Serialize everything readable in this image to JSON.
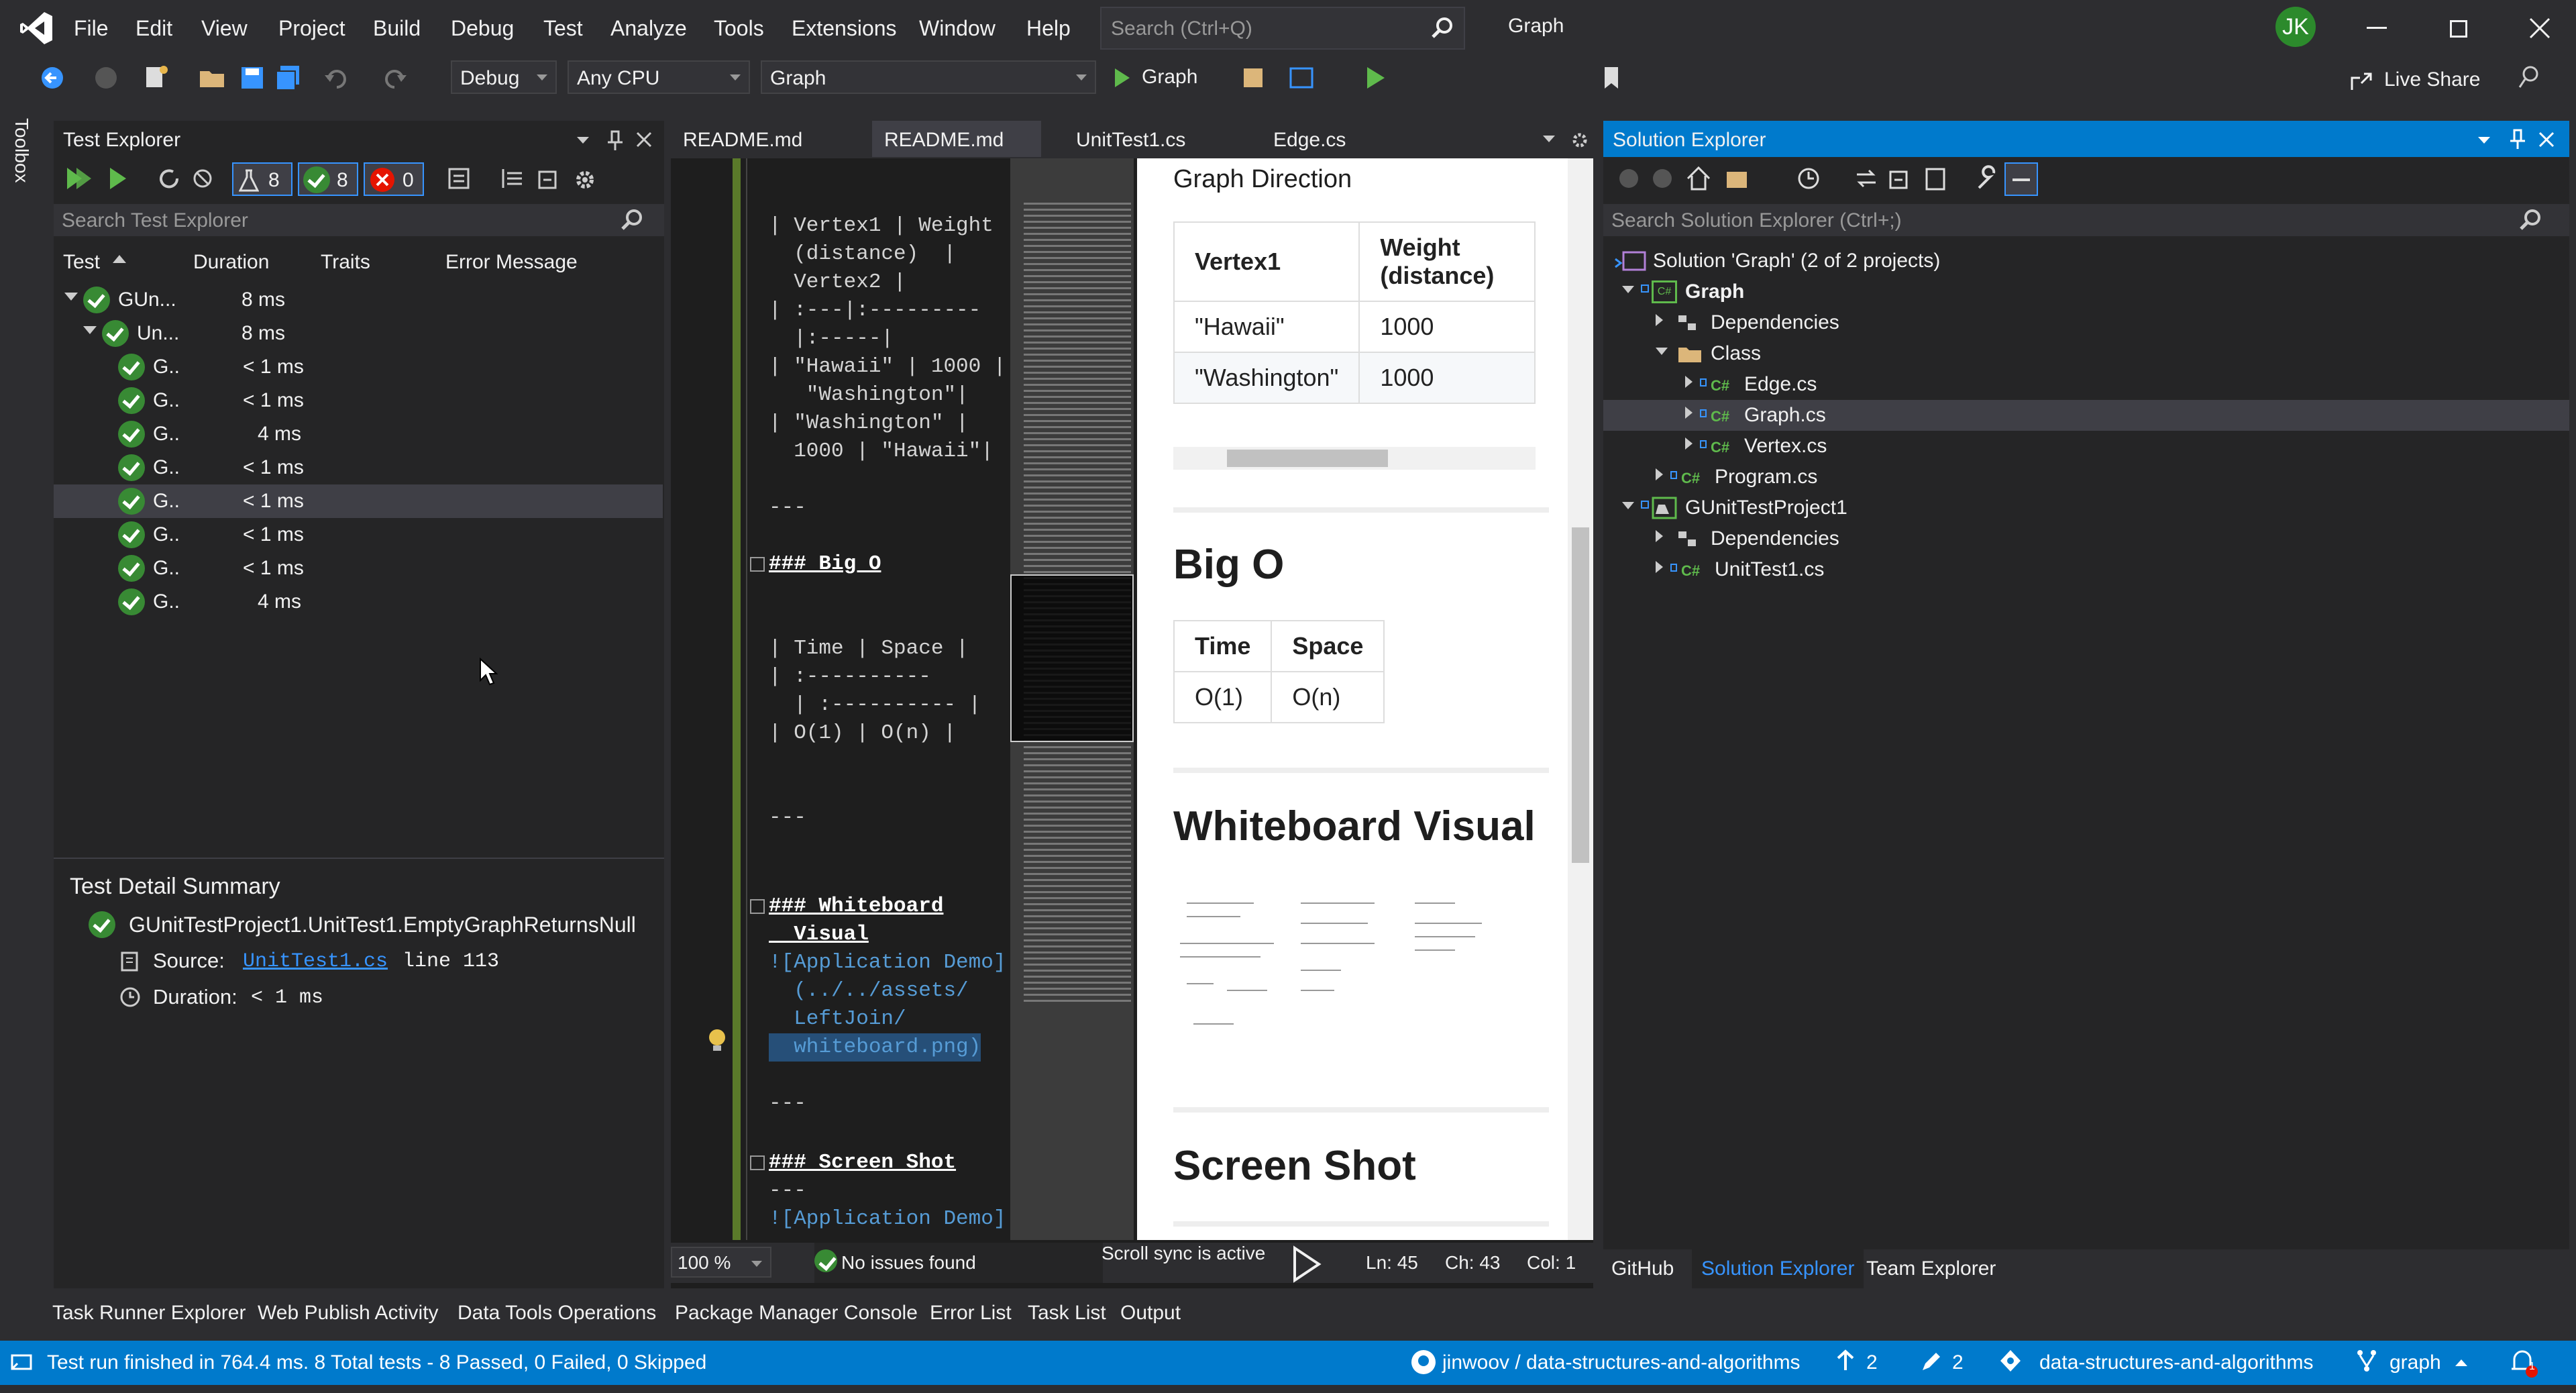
{
  "menu": [
    "File",
    "Edit",
    "View",
    "Project",
    "Build",
    "Debug",
    "Test",
    "Analyze",
    "Tools",
    "Extensions",
    "Window",
    "Help"
  ],
  "search": {
    "placeholder": "Search (Ctrl+Q)"
  },
  "solution_name": "Graph",
  "user_initials": "JK",
  "live_share": "Live Share",
  "toolbar": {
    "config": "Debug",
    "platform": "Any CPU",
    "startup": "Graph",
    "run_label": "Graph"
  },
  "toolbox_label": "Toolbox",
  "test_explorer": {
    "title": "Test Explorer",
    "counts": {
      "total": "8",
      "passed": "8",
      "failed": "0"
    },
    "search_placeholder": "Search Test Explorer",
    "columns": [
      "Test",
      "Duration",
      "Traits",
      "Error Message"
    ],
    "rows": [
      {
        "name": "GUn...",
        "duration": "8 ms"
      },
      {
        "name": "Un...",
        "duration": "8 ms"
      },
      {
        "name": "G..",
        "duration": "< 1 ms"
      },
      {
        "name": "G..",
        "duration": "< 1 ms"
      },
      {
        "name": "G..",
        "duration": "4 ms"
      },
      {
        "name": "G..",
        "duration": "< 1 ms"
      },
      {
        "name": "G..",
        "duration": "< 1 ms"
      },
      {
        "name": "G..",
        "duration": "< 1 ms"
      },
      {
        "name": "G..",
        "duration": "< 1 ms"
      },
      {
        "name": "G..",
        "duration": "4 ms"
      }
    ],
    "detail": {
      "title": "Test Detail Summary",
      "test_name": "GUnitTestProject1.UnitTest1.EmptyGraphReturnsNull",
      "source_label": "Source:",
      "source_file": "UnitTest1.cs",
      "source_line": "line 113",
      "duration_label": "Duration:",
      "duration_value": "< 1 ms"
    }
  },
  "editor": {
    "tabs": [
      "README.md",
      "README.md",
      "UnitTest1.cs",
      "Edge.cs"
    ],
    "code": [
      "| Vertex1 | Weight",
      "  (distance)  |",
      "  Vertex2 |",
      "| :---|:---------",
      "  |:-----|",
      "| \"Hawaii\" | 1000 |",
      "   \"Washington\"|",
      "| \"Washington\" |",
      "  1000 | \"Hawaii\"|",
      "---",
      "### Big O",
      "| Time | Space |",
      "| :----------",
      "  | :---------- |",
      "| O(1) | O(n) |",
      "---",
      "### Whiteboard",
      "  Visual",
      "![Application Demo]",
      "  (../../assets/",
      "  LeftJoin/",
      "  whiteboard.png)",
      "---",
      "### Screen Shot",
      "---",
      "![Application Demo]"
    ],
    "zoom": "100 %",
    "issues": "No issues found",
    "scroll_sync": "Scroll sync is active",
    "ln": "Ln: 45",
    "ch": "Ch: 43",
    "col": "Col: 1"
  },
  "preview": {
    "graph_direction": "Graph Direction",
    "table1": {
      "headers": [
        "Vertex1",
        "Weight (distance)"
      ],
      "rows": [
        [
          "\"Hawaii\"",
          "1000"
        ],
        [
          "\"Washington\"",
          "1000"
        ]
      ]
    },
    "big_o": "Big O",
    "table2": {
      "headers": [
        "Time",
        "Space"
      ],
      "rows": [
        [
          "O(1)",
          "O(n)"
        ]
      ]
    },
    "whiteboard": "Whiteboard Visual",
    "screen_shot": "Screen Shot"
  },
  "solution_explorer": {
    "title": "Solution Explorer",
    "search_placeholder": "Search Solution Explorer (Ctrl+;)",
    "items": [
      {
        "label": "Solution 'Graph' (2 of 2 projects)"
      },
      {
        "label": "Graph"
      },
      {
        "label": "Dependencies"
      },
      {
        "label": "Class"
      },
      {
        "label": "Edge.cs"
      },
      {
        "label": "Graph.cs"
      },
      {
        "label": "Vertex.cs"
      },
      {
        "label": "Program.cs"
      },
      {
        "label": "GUnitTestProject1"
      },
      {
        "label": "Dependencies"
      },
      {
        "label": "UnitTest1.cs"
      }
    ],
    "bottom_tabs": [
      "GitHub",
      "Solution Explorer",
      "Team Explorer"
    ]
  },
  "bottom_tabs": [
    "Task Runner Explorer",
    "Web Publish Activity",
    "Data Tools Operations",
    "Package Manager Console",
    "Error List",
    "Task List",
    "Output"
  ],
  "status": {
    "message": "Test run finished in 764.4 ms. 8 Total tests - 8 Passed, 0 Failed, 0 Skipped",
    "repo": "jinwoov / data-structures-and-algorithms",
    "up": "2",
    "edits": "2",
    "repo2": "data-structures-and-algorithms",
    "branch": "graph",
    "notifications": "1"
  }
}
